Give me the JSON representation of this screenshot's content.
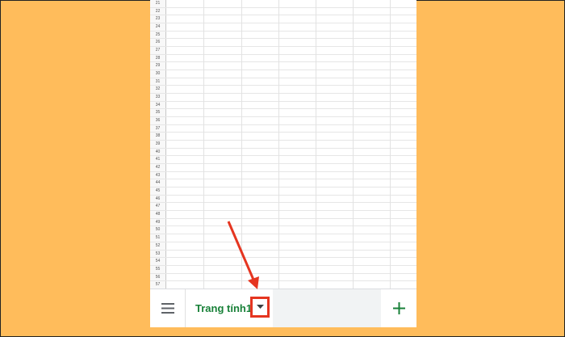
{
  "rows": [
    "21",
    "22",
    "23",
    "24",
    "25",
    "26",
    "27",
    "28",
    "29",
    "30",
    "31",
    "32",
    "33",
    "34",
    "35",
    "36",
    "37",
    "38",
    "39",
    "40",
    "41",
    "42",
    "43",
    "44",
    "45",
    "46",
    "47",
    "48",
    "49",
    "50",
    "51",
    "52",
    "53",
    "54",
    "55",
    "56",
    "57"
  ],
  "bottom_bar": {
    "menu_icon": "hamburger-menu-icon",
    "sheet_tab_label": "Trang tính1",
    "dropdown_icon": "caret-down-icon",
    "add_icon": "plus-icon"
  },
  "colors": {
    "background": "#ffbc5b",
    "sheet_tab_text": "#188038",
    "highlight": "#e53520",
    "add_icon": "#188038"
  }
}
